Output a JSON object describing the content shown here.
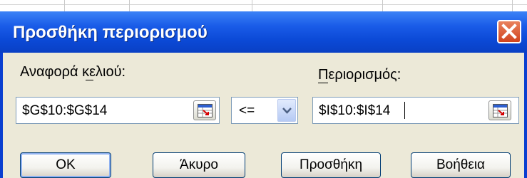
{
  "dialog": {
    "title": "Προσθήκη περιορισμού",
    "close_icon": "close-x-icon"
  },
  "cell_reference": {
    "label": "Αναφορά κελιού:",
    "value": "$G$10:$G$14",
    "ref_button_icon": "collapse-dialog-icon"
  },
  "operator": {
    "selected": "<=",
    "dropdown_icon": "chevron-down-icon"
  },
  "constraint": {
    "label": "Περιορισμός:",
    "value": "$I$10:$I$14",
    "ref_button_icon": "collapse-dialog-icon"
  },
  "buttons": {
    "ok": "OK",
    "cancel": "Άκυρο",
    "add": "Προσθήκη",
    "help": "Βοήθεια"
  },
  "colors": {
    "titlebar": "#0b49d6",
    "client": "#ece9d8",
    "close_button": "#d1441f",
    "field_border": "#7f9db9"
  }
}
